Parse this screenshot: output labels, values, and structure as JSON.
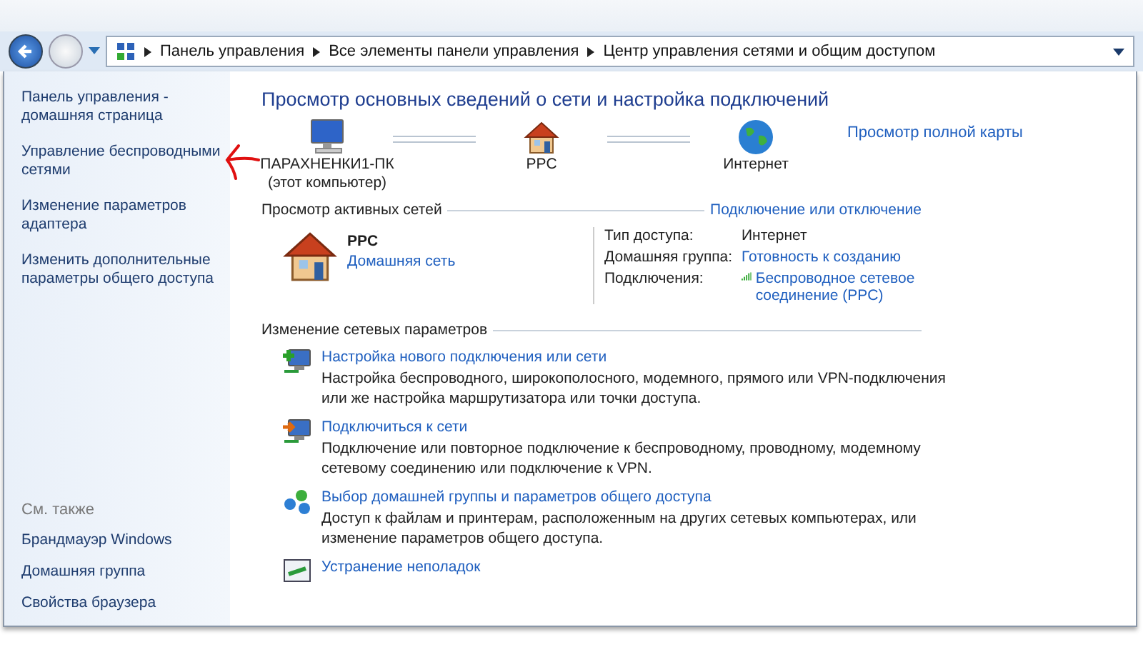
{
  "nav": {
    "breadcrumbs": [
      "Панель управления",
      "Все элементы панели управления",
      "Центр управления сетями и общим доступом"
    ]
  },
  "sidebar": {
    "links": [
      "Панель управления - домашняя страница",
      "Управление беспроводными сетями",
      "Изменение параметров адаптера",
      "Изменить дополнительные параметры общего доступа"
    ],
    "see_also_title": "См. также",
    "see_also": [
      "Брандмауэр Windows",
      "Домашняя группа",
      "Свойства браузера"
    ]
  },
  "main": {
    "title": "Просмотр основных сведений о сети и настройка подключений",
    "full_map_link": "Просмотр полной карты",
    "map_nodes": [
      {
        "kind": "computer",
        "label": "ПАРАХНЕНКИ1-ПК",
        "sublabel": "(этот компьютер)"
      },
      {
        "kind": "house",
        "label": "PPC"
      },
      {
        "kind": "globe",
        "label": "Интернет"
      }
    ],
    "active_networks": {
      "heading": "Просмотр активных сетей",
      "action": "Подключение или отключение",
      "network": {
        "name": "PPC",
        "type": "Домашняя сеть"
      },
      "details": [
        {
          "kind": "text",
          "label": "Тип доступа:",
          "value": "Интернет"
        },
        {
          "kind": "link",
          "label": "Домашняя группа:",
          "value": "Готовность к созданию"
        },
        {
          "kind": "wifi-link",
          "label": "Подключения:",
          "value": "Беспроводное сетевое соединение (PPC)"
        }
      ]
    },
    "change_settings": {
      "heading": "Изменение сетевых параметров",
      "tasks": [
        {
          "kind": "new-connection",
          "title": "Настройка нового подключения или сети",
          "description": "Настройка беспроводного, широкополосного, модемного, прямого или VPN-подключения или же настройка маршрутизатора или точки доступа."
        },
        {
          "kind": "connect",
          "title": "Подключиться к сети",
          "description": "Подключение или повторное подключение к беспроводному, проводному, модемному сетевому соединению или подключение к VPN."
        },
        {
          "kind": "homegroup",
          "title": "Выбор домашней группы и параметров общего доступа",
          "description": "Доступ к файлам и принтерам, расположенным на других сетевых компьютерах, или изменение параметров общего доступа."
        },
        {
          "kind": "troubleshoot",
          "title": "Устранение неполадок"
        }
      ]
    }
  }
}
